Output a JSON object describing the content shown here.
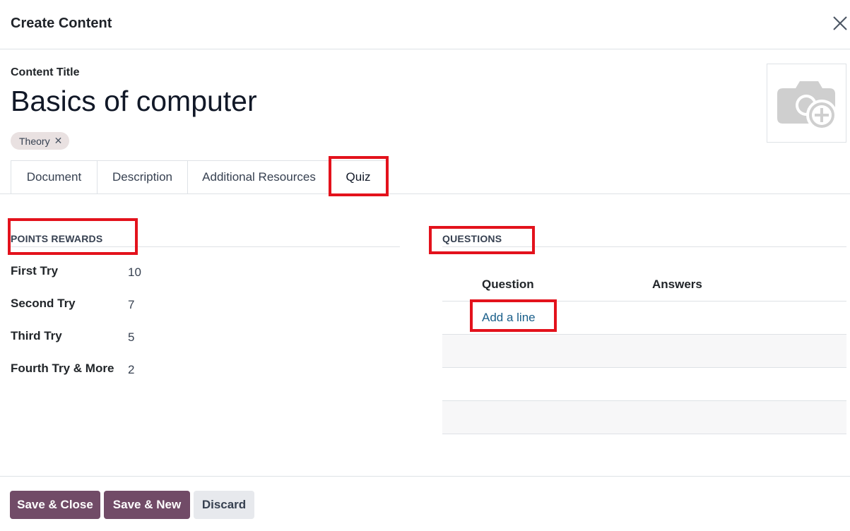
{
  "modal": {
    "title": "Create Content"
  },
  "form": {
    "title_label": "Content Title",
    "title_value": "Basics of computer",
    "tags": [
      {
        "label": "Theory"
      }
    ]
  },
  "icons": {
    "close": "close-icon",
    "tag_remove": "x-icon",
    "image_upload": "camera-plus-icon"
  },
  "tabs": [
    {
      "label": "Document"
    },
    {
      "label": "Description"
    },
    {
      "label": "Additional Resources"
    },
    {
      "label": "Quiz",
      "active": true
    }
  ],
  "points_rewards": {
    "title": "POINTS REWARDS",
    "rows": [
      {
        "label": "First Try",
        "value": "10"
      },
      {
        "label": "Second Try",
        "value": "7"
      },
      {
        "label": "Third Try",
        "value": "5"
      },
      {
        "label": "Fourth Try & More",
        "value": "2"
      }
    ]
  },
  "questions": {
    "title": "QUESTIONS",
    "columns": [
      "Question",
      "Answers"
    ],
    "add_line": "Add a line"
  },
  "footer": {
    "save_close": "Save & Close",
    "save_new": "Save & New",
    "discard": "Discard"
  },
  "colors": {
    "primary": "#714b67",
    "highlight": "#e3121c",
    "link": "#1a5f8a",
    "tag_bg": "#e9e1e1"
  }
}
